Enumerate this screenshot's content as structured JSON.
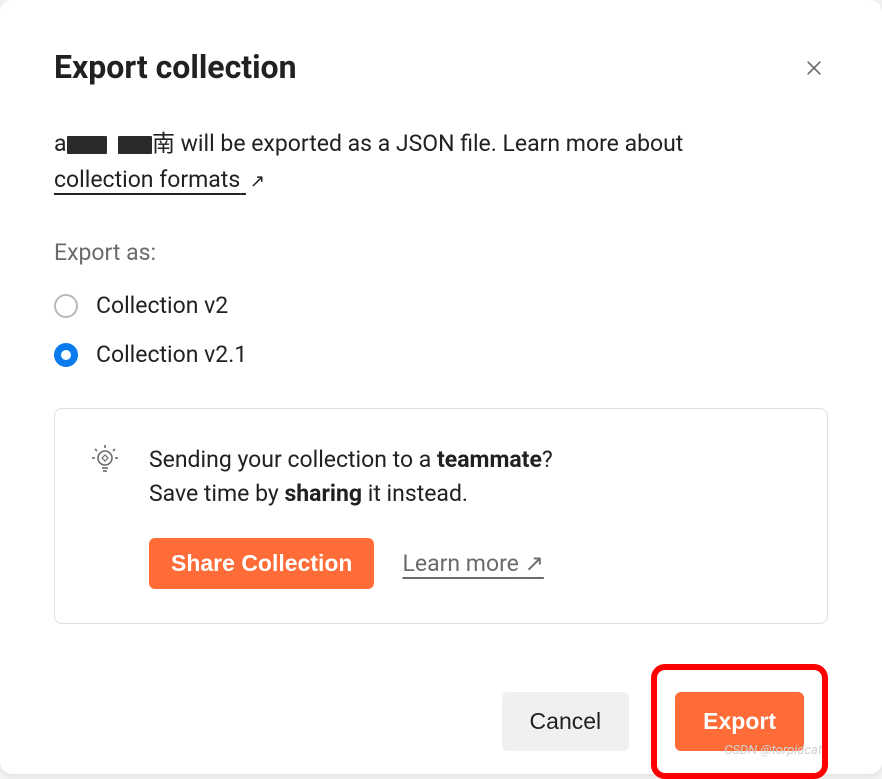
{
  "modal": {
    "title": "Export collection",
    "description_prefix": "a",
    "description_mid": "南",
    "description_text": " will be exported as a JSON file. Learn more about ",
    "collection_formats_link": "collection formats",
    "export_as_label": "Export as:",
    "options": [
      {
        "label": "Collection v2",
        "selected": false
      },
      {
        "label": "Collection v2.1",
        "selected": true
      }
    ],
    "info": {
      "text_1": "Sending your collection to a ",
      "text_1_bold": "teammate",
      "text_1_suffix": "?",
      "text_2": "Save time by ",
      "text_2_bold": "sharing",
      "text_2_suffix": " it instead.",
      "share_button": "Share Collection",
      "learn_more": "Learn more"
    },
    "footer": {
      "cancel": "Cancel",
      "export": "Export"
    }
  },
  "watermark": "CSDN @torpidcat"
}
